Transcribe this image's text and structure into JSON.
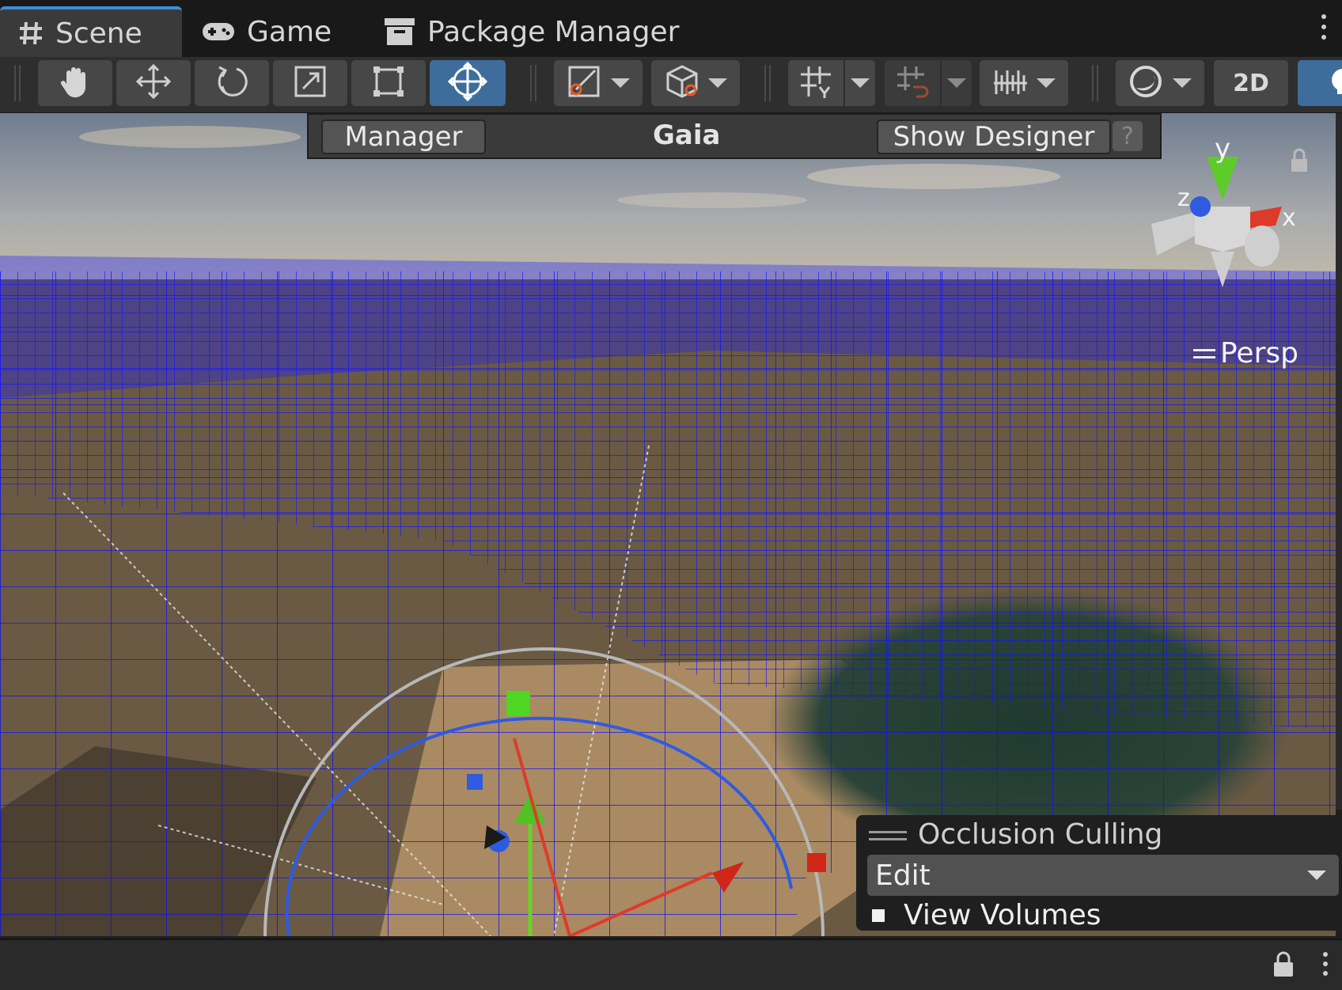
{
  "tabs": [
    {
      "label": "Scene",
      "icon": "grid-hash-icon",
      "active": true
    },
    {
      "label": "Game",
      "icon": "gamepad-icon",
      "active": false
    },
    {
      "label": "Package Manager",
      "icon": "package-icon",
      "active": false
    }
  ],
  "toolbar": {
    "tools": [
      "hand-tool",
      "move-tool",
      "rotate-tool",
      "scale-tool",
      "rect-tool",
      "transform-tool"
    ],
    "selected_tool": "transform-tool",
    "label_2d": "2D"
  },
  "gaia": {
    "manager_label": "Manager",
    "title": "Gaia",
    "designer_label": "Show Designer",
    "help_label": "?"
  },
  "gizmo": {
    "y_label": "y",
    "x_label": "x",
    "z_label": "z",
    "projection": "Persp"
  },
  "occlusion": {
    "title": "Occlusion Culling",
    "mode": "Edit",
    "view_volumes_label": "View Volumes",
    "view_volumes_checked": true
  },
  "colors": {
    "accent": "#3e6d9c",
    "wire": "#1a1aff",
    "axis_x": "#e03a2a",
    "axis_y": "#6ad12a",
    "axis_z": "#2a5be0"
  }
}
